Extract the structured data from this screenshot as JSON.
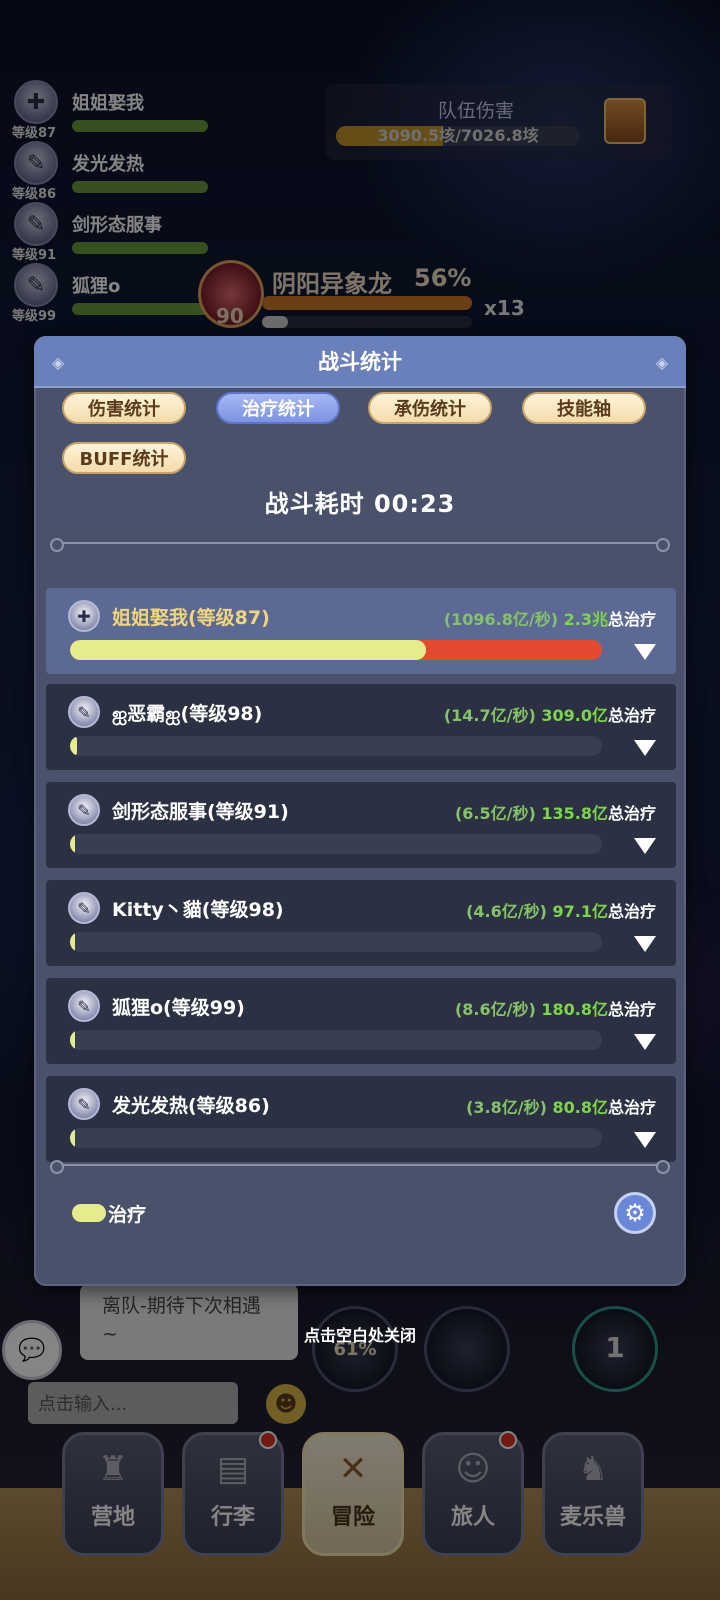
{
  "party": [
    {
      "name": "姐姐娶我",
      "level": "等级87",
      "icon": "cross-shield-icon",
      "glyph": "✚"
    },
    {
      "name": "发光发热",
      "level": "等级86",
      "icon": "staff-icon",
      "glyph": "✎"
    },
    {
      "name": "剑形态服事",
      "level": "等级91",
      "icon": "staff-icon",
      "glyph": "✎"
    },
    {
      "name": "狐狸o",
      "level": "等级99",
      "icon": "staff-icon",
      "glyph": "✎"
    }
  ],
  "team_damage": {
    "label": "队伍伤害",
    "value": "3090.5垓/7026.8垓",
    "progress": 0.44
  },
  "boss": {
    "name": "阴阳异象龙",
    "percent": "56%",
    "level": "90",
    "multiplier": "x13"
  },
  "modal": {
    "title": "战斗统计",
    "tabs": [
      "伤害统计",
      "治疗统计",
      "承伤统计",
      "技能轴",
      "BUFF统计"
    ],
    "active_tab": "治疗统计",
    "timer_label": "战斗耗时",
    "timer_value": "00:23",
    "rows": [
      {
        "name": "姐姐娶我(等级87)",
        "rate": "(1096.8亿/秒)",
        "total": "2.3兆",
        "suffix": "总治疗",
        "fraction": 0.67,
        "icon": "cross-shield-icon",
        "glyph": "✚"
      },
      {
        "name": "ஐ恶霸ஐ(等级98)",
        "rate": "(14.7亿/秒)",
        "total": "309.0亿",
        "suffix": "总治疗",
        "fraction": 0.013,
        "icon": "staff-icon",
        "glyph": "✎"
      },
      {
        "name": "剑形态服事(等级91)",
        "rate": "(6.5亿/秒)",
        "total": "135.8亿",
        "suffix": "总治疗",
        "fraction": 0.006,
        "icon": "staff-icon",
        "glyph": "✎"
      },
      {
        "name": "Kitty丶貓(等级98)",
        "rate": "(4.6亿/秒)",
        "total": "97.1亿",
        "suffix": "总治疗",
        "fraction": 0.004,
        "icon": "staff-icon",
        "glyph": "✎"
      },
      {
        "name": "狐狸o(等级99)",
        "rate": "(8.6亿/秒)",
        "total": "180.8亿",
        "suffix": "总治疗",
        "fraction": 0.008,
        "icon": "staff-icon",
        "glyph": "✎"
      },
      {
        "name": "发光发热(等级86)",
        "rate": "(3.8亿/秒)",
        "total": "80.8亿",
        "suffix": "总治疗",
        "fraction": 0.003,
        "icon": "staff-icon",
        "glyph": "✎"
      }
    ],
    "legend_label": "治疗",
    "legend_color": "#e6ec8e",
    "settings_icon": "gear-icon"
  },
  "bubble_text": "离队-期待下次相遇~",
  "close_hint": "点击空白处关闭",
  "chat_placeholder": "点击输入...",
  "skills": [
    {
      "label": "61%"
    },
    {
      "label": ""
    },
    {
      "label": "1"
    }
  ],
  "nav": [
    {
      "label": "营地",
      "glyph": "♜"
    },
    {
      "label": "行李",
      "glyph": "▤",
      "badge": true
    },
    {
      "label": "冒险",
      "glyph": "✕",
      "active": true
    },
    {
      "label": "旅人",
      "glyph": "☺",
      "badge": true
    },
    {
      "label": "麦乐兽",
      "glyph": "♞"
    }
  ],
  "colors": {
    "accent": "#6a80ba",
    "heal_bar": "#e6ec8e",
    "remaining": "#e24b30",
    "heal_total": "#7ed54c"
  }
}
